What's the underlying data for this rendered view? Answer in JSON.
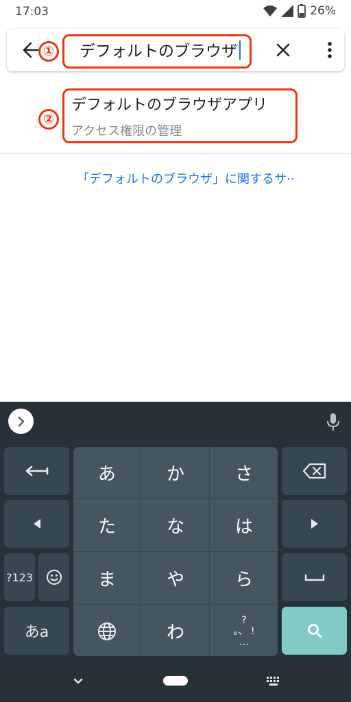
{
  "status_bar": {
    "time": "17:03",
    "battery": "26%"
  },
  "search": {
    "query": "デフォルトのブラウザ"
  },
  "annotations": {
    "marker1": "①",
    "marker2": "②"
  },
  "suggestion": {
    "title": "デフォルトのブラウザアプリ",
    "subtitle": "アクセス権限の管理"
  },
  "related_link": "「デフォルトのブラウザ」に関するサ··",
  "keyboard": {
    "kana": [
      "あ",
      "か",
      "さ",
      "た",
      "な",
      "は",
      "ま",
      "や",
      "ら",
      "わ"
    ],
    "num_toggle": "?123",
    "mode_toggle": "あa",
    "punct_top": "?",
    "punct_mid": "。、 !",
    "punct_bot": "…",
    "colors": {
      "background": "#263238",
      "key": "#37474f",
      "search": "#80cbc4"
    }
  },
  "icons": [
    "back-arrow-icon",
    "clear-icon",
    "more-vert-icon",
    "wifi-icon",
    "signal-icon",
    "battery-icon",
    "mic-icon",
    "globe-icon",
    "emoji-icon",
    "backspace-icon",
    "enter-icon",
    "search-icon",
    "space-icon"
  ]
}
